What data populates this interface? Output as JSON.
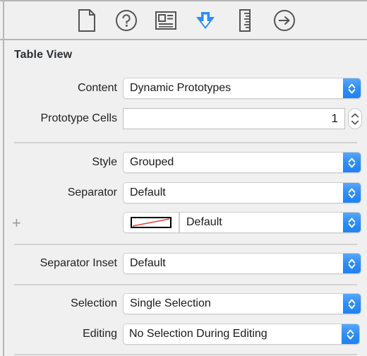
{
  "window": {
    "inspector_title": "Table View"
  },
  "toolbar": {
    "items": [
      {
        "name": "file-inspector-icon",
        "tooltip": "File inspector",
        "selected": false
      },
      {
        "name": "quick-help-inspector-icon",
        "tooltip": "Quick Help inspector",
        "selected": false
      },
      {
        "name": "identity-inspector-icon",
        "tooltip": "Identity inspector",
        "selected": false
      },
      {
        "name": "attributes-inspector-icon",
        "tooltip": "Attributes inspector",
        "selected": true
      },
      {
        "name": "size-inspector-icon",
        "tooltip": "Size inspector",
        "selected": false
      },
      {
        "name": "connections-inspector-icon",
        "tooltip": "Connections inspector",
        "selected": false
      }
    ],
    "selected_index": 3,
    "selected_color": "#2f8df6"
  },
  "rows": {
    "content": {
      "label": "Content",
      "value": "Dynamic Prototypes",
      "control": "popup"
    },
    "prototype_cells": {
      "label": "Prototype Cells",
      "value": "1",
      "control": "stepper-field"
    },
    "style": {
      "label": "Style",
      "value": "Grouped",
      "control": "popup"
    },
    "separator": {
      "label": "Separator",
      "value": "Default",
      "control": "popup"
    },
    "separator_color": {
      "label": "+",
      "swatch": "none-red-slash",
      "value": "Default",
      "control": "color-popup"
    },
    "separator_inset": {
      "label": "Separator Inset",
      "value": "Default",
      "control": "popup"
    },
    "selection": {
      "label": "Selection",
      "value": "Single Selection",
      "control": "popup"
    },
    "editing": {
      "label": "Editing",
      "value": "No Selection During Editing",
      "control": "popup"
    }
  },
  "colors": {
    "panel_background": "#f0f0f0",
    "divider": "#d2d2d2",
    "popup_accent": "#2f8df6",
    "text": "#1a1a1a",
    "title_text": "#2b2f33",
    "swatch_slash": "#e8413a",
    "icon_stroke": "#545454"
  }
}
